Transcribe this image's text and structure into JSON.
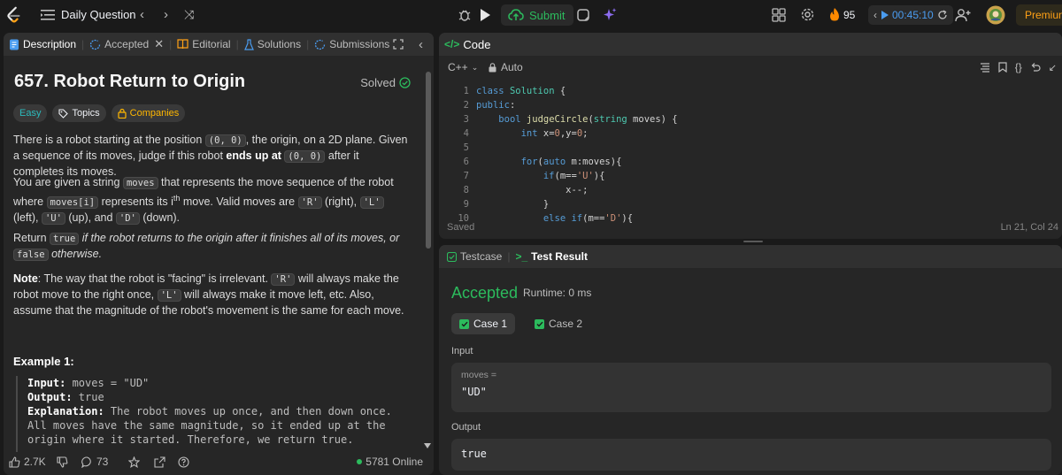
{
  "topbar": {
    "title": "Daily Question",
    "submit_label": "Submit",
    "streak": "95",
    "timer": "00:45:10",
    "premium": "Premium"
  },
  "description_tabs": [
    {
      "label": "Description"
    },
    {
      "label": "Accepted"
    },
    {
      "label": "Editorial"
    },
    {
      "label": "Solutions"
    },
    {
      "label": "Submissions"
    }
  ],
  "problem": {
    "title": "657. Robot Return to Origin",
    "status": "Solved",
    "difficulty": "Easy",
    "topics_label": "Topics",
    "companies_label": "Companies",
    "p1_a": "There is a robot starting at the position ",
    "p1_code1": "(0, 0)",
    "p1_b": ", the origin, on a 2D plane. Given a sequence of its moves, judge if this robot ",
    "p1_bold": "ends up at",
    "p1_code2": "(0, 0)",
    "p1_c": " after it completes its moves.",
    "p2_a": "You are given a string ",
    "p2_code1": "moves",
    "p2_b": " that represents the move sequence of the robot where ",
    "p2_code2": "moves[i]",
    "p2_c": " represents its i",
    "p2_sup": "th",
    "p2_d": " move. Valid moves are ",
    "p2_r": "'R'",
    "p2_r_txt": " (right), ",
    "p2_l": "'L'",
    "p2_l_txt": " (left), ",
    "p2_u": "'U'",
    "p2_u_txt": " (up), and ",
    "p2_dcode": "'D'",
    "p2_d_txt": " (down).",
    "p3_a": "Return ",
    "p3_code1": "true",
    "p3_b": " if the robot returns to the origin after it finishes all of its moves, or ",
    "p3_code2": "false",
    "p3_c": " otherwise.",
    "p4_bold": "Note",
    "p4_a": ": The way that the robot is \"facing\" is irrelevant. ",
    "p4_code1": "'R'",
    "p4_b": " will always make the robot move to the right once, ",
    "p4_code2": "'L'",
    "p4_c": " will always make it move left, etc. Also, assume that the magnitude of the robot's movement is the same for each move.",
    "example_title": "Example 1:",
    "ex_input_label": "Input:",
    "ex_input": " moves = \"UD\"",
    "ex_output_label": "Output:",
    "ex_output": " true",
    "ex_expl_label": "Explanation:",
    "ex_expl": " The robot moves up once, and then down once. All moves have the same magnitude, so it ended up at the origin where it started. Therefore, we return true."
  },
  "desc_footer": {
    "likes": "2.7K",
    "comments": "73",
    "online": "5781 Online"
  },
  "code_panel": {
    "title": "Code",
    "language": "C++",
    "mode": "Auto",
    "saved": "Saved",
    "cursor": "Ln 21, Col 24",
    "line_numbers": [
      "1",
      "2",
      "3",
      "4",
      "5",
      "6",
      "7",
      "8",
      "9",
      "10"
    ]
  },
  "test_panel": {
    "tab_testcase": "Testcase",
    "tab_result": "Test Result",
    "verdict": "Accepted",
    "runtime": "Runtime: 0 ms",
    "case1": "Case 1",
    "case2": "Case 2",
    "input_label": "Input",
    "input_name": "moves =",
    "input_value": "\"UD\"",
    "output_label": "Output",
    "output_value": "true"
  },
  "colors": {
    "accent_green": "#2cbb5d",
    "accent_orange": "#ffa116",
    "panel": "#262626",
    "background": "#1a1a1a"
  }
}
